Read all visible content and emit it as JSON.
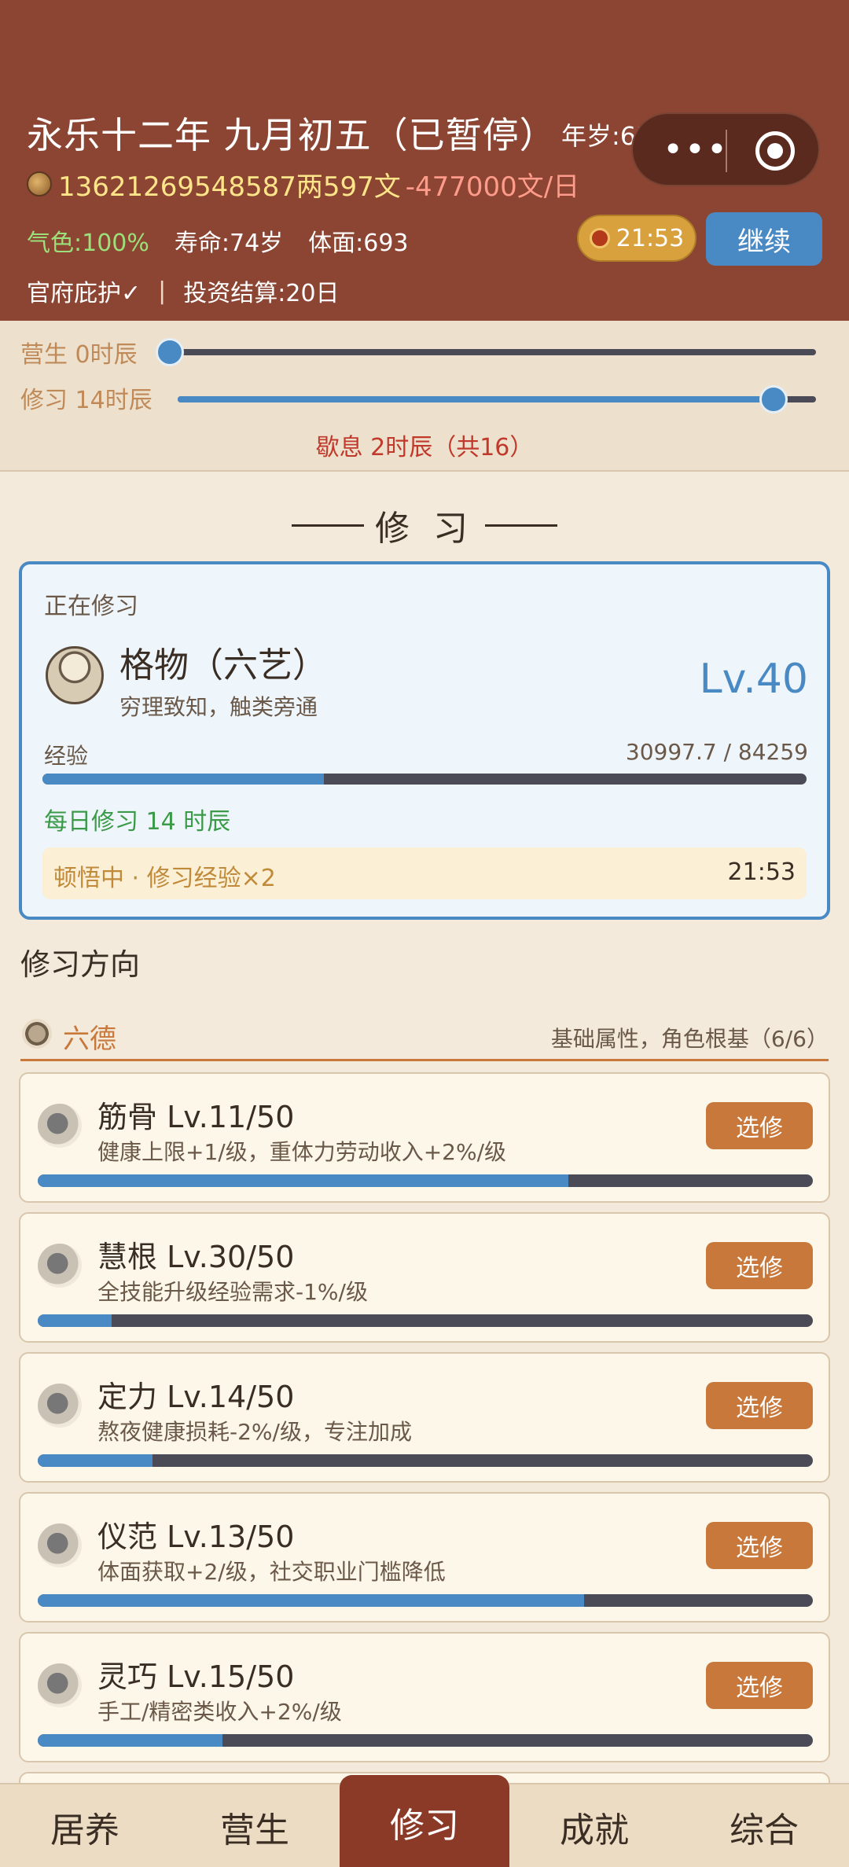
{
  "header": {
    "date": "永乐十二年 九月初五（已暂停）",
    "age": "年岁:63",
    "money": "13621269548587两597文",
    "rate": "-477000文/日",
    "qise": "气色:100%",
    "lifespan": "寿命:74岁",
    "face": "体面:693",
    "timer": "21:53",
    "continue_label": "继续",
    "protection": "官府庇护✓",
    "divider": "|",
    "settlement": "投资结算:20日"
  },
  "capsule": {
    "more_icon": "more-dots-icon",
    "close_icon": "target-icon"
  },
  "sliders": {
    "work": {
      "label": "营生 0时辰",
      "value": 0
    },
    "study": {
      "label": "修习 14时辰",
      "value": 14
    },
    "max": 16,
    "rest": "歇息 2时辰（共16）"
  },
  "section_title": "修 习",
  "current": {
    "label": "正在修习",
    "name": "格物（六艺）",
    "desc": "穷理致知，触类旁通",
    "level": "Lv.40",
    "exp_label": "经验",
    "exp_value": "30997.7 / 84259",
    "exp_progress": 0.368,
    "daily": "每日修习 14 时辰",
    "insight": "顿悟中 · 修习经验×2",
    "insight_time": "21:53"
  },
  "directions_title": "修习方向",
  "group": {
    "name": "六德",
    "sub": "基础属性，角色根基（6/6）"
  },
  "skills": [
    {
      "name": "筋骨  Lv.11/50",
      "desc": "健康上限+1/级，重体力劳动收入+2%/级",
      "button": "选修",
      "progress": 0.685
    },
    {
      "name": "慧根  Lv.30/50",
      "desc": "全技能升级经验需求-1%/级",
      "button": "选修",
      "progress": 0.095
    },
    {
      "name": "定力  Lv.14/50",
      "desc": "熬夜健康损耗-2%/级，专注加成",
      "button": "选修",
      "progress": 0.148
    },
    {
      "name": "仪范  Lv.13/50",
      "desc": "体面获取+2/级，社交职业门槛降低",
      "button": "选修",
      "progress": 0.705
    },
    {
      "name": "灵巧  Lv.15/50",
      "desc": "手工/精密类收入+2%/级",
      "button": "选修",
      "progress": 0.238
    }
  ],
  "nav": [
    "居养",
    "营生",
    "修习",
    "成就",
    "综合"
  ],
  "colors": {
    "header": "#8b4532",
    "accent": "#4a8ac4",
    "orange": "#c8783a"
  }
}
